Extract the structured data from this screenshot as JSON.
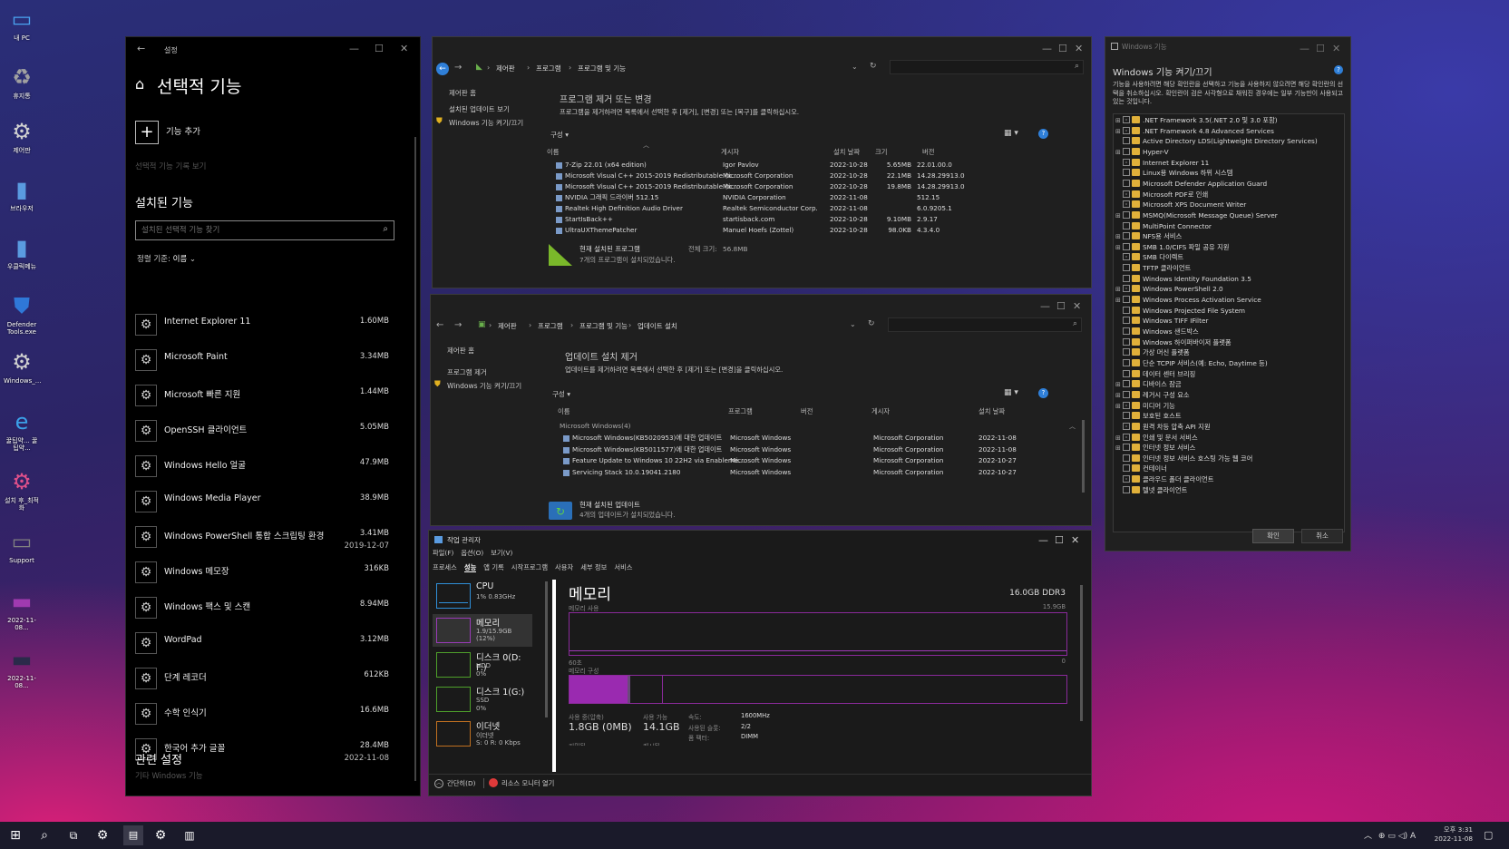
{
  "desktop": {
    "icons": [
      {
        "label": "내 PC",
        "icon": "monitor-icon",
        "color": "#4aa3f0"
      },
      {
        "label": "휴지통",
        "icon": "recycle-bin-icon",
        "color": "#a0a0a0"
      },
      {
        "label": "제어판",
        "icon": "gear-icon",
        "color": "#d0d0d0"
      },
      {
        "label": "브라우저",
        "icon": "document-icon",
        "color": "#5a9be0"
      },
      {
        "label": "우클릭메뉴",
        "icon": "document-icon",
        "color": "#5a9be0"
      },
      {
        "label": "Defender Tools.exe",
        "icon": "shield-icon",
        "color": "#2f78d8"
      },
      {
        "label": "Windows_...",
        "icon": "gear-icon",
        "color": "#d0d0d0"
      },
      {
        "label": "꿀팁약... 꿀팁약...",
        "icon": "ie-icon",
        "color": "#3ba0e8"
      },
      {
        "label": "설치 후_최적화",
        "icon": "gear-icon",
        "color": "#e0508a"
      },
      {
        "label": "Support",
        "icon": "monitor-icon",
        "color": "#808080"
      },
      {
        "label": "2022-11-08...",
        "icon": "screenshot-icon",
        "color": "#a03ab0"
      },
      {
        "label": "2022-11-08...",
        "icon": "screenshot-icon",
        "color": "#2a2a4a"
      }
    ]
  },
  "settings": {
    "title": "설정",
    "page_title": "선택적 기능",
    "add_feature": "기능 추가",
    "history": "선택적 기능 기록 보기",
    "installed_heading": "설치된 기능",
    "search_placeholder": "설치된 선택적 기능 찾기",
    "sort_label": "정렬 기준:",
    "sort_value": "이름",
    "items": [
      {
        "name": "Internet Explorer 11",
        "size": "1.60MB",
        "date": ""
      },
      {
        "name": "Microsoft Paint",
        "size": "3.34MB",
        "date": ""
      },
      {
        "name": "Microsoft 빠른 지원",
        "size": "1.44MB",
        "date": ""
      },
      {
        "name": "OpenSSH 클라이언트",
        "size": "5.05MB",
        "date": ""
      },
      {
        "name": "Windows Hello 얼굴",
        "size": "47.9MB",
        "date": ""
      },
      {
        "name": "Windows Media Player",
        "size": "38.9MB",
        "date": ""
      },
      {
        "name": "Windows PowerShell 통합 스크립팅 환경",
        "size": "3.41MB",
        "date": "2019-12-07"
      },
      {
        "name": "Windows 메모장",
        "size": "316KB",
        "date": ""
      },
      {
        "name": "Windows 팩스 및 스캔",
        "size": "8.94MB",
        "date": ""
      },
      {
        "name": "WordPad",
        "size": "3.12MB",
        "date": ""
      },
      {
        "name": "단계 레코더",
        "size": "612KB",
        "date": ""
      },
      {
        "name": "수학 인식기",
        "size": "16.6MB",
        "date": ""
      },
      {
        "name": "한국어 추가 글꼴",
        "size": "28.4MB",
        "date": "2022-11-08"
      }
    ],
    "related_heading": "관련 설정",
    "related_link": "기타 Windows 기능"
  },
  "programs": {
    "breadcrumb": [
      "제어판",
      "프로그램",
      "프로그램 및 기능"
    ],
    "sidebar": [
      "제어판 홈",
      "설치된 업데이트 보기",
      "Windows 기능 켜기/끄기"
    ],
    "heading": "프로그램 제거 또는 변경",
    "description": "프로그램을 제거하려면 목록에서 선택한 후 [제거], [변경] 또는 [복구]를 클릭하십시오.",
    "organize": "구성",
    "columns": [
      "이름",
      "게시자",
      "설치 날짜",
      "크기",
      "버전"
    ],
    "rows": [
      {
        "name": "7-Zip 22.01 (x64 edition)",
        "publisher": "Igor Pavlov",
        "date": "2022-10-28",
        "size": "5.65MB",
        "version": "22.01.00.0"
      },
      {
        "name": "Microsoft Visual C++ 2015-2019 Redistributable (x...",
        "publisher": "Microsoft Corporation",
        "date": "2022-10-28",
        "size": "22.1MB",
        "version": "14.28.29913.0"
      },
      {
        "name": "Microsoft Visual C++ 2015-2019 Redistributable (x...",
        "publisher": "Microsoft Corporation",
        "date": "2022-10-28",
        "size": "19.8MB",
        "version": "14.28.29913.0"
      },
      {
        "name": "NVIDIA 그래픽 드라이버 512.15",
        "publisher": "NVIDIA Corporation",
        "date": "2022-11-08",
        "size": "",
        "version": "512.15"
      },
      {
        "name": "Realtek High Definition Audio Driver",
        "publisher": "Realtek Semiconductor Corp.",
        "date": "2022-11-08",
        "size": "",
        "version": "6.0.9205.1"
      },
      {
        "name": "StartIsBack++",
        "publisher": "startisback.com",
        "date": "2022-10-28",
        "size": "9.10MB",
        "version": "2.9.17"
      },
      {
        "name": "UltraUXThemePatcher",
        "publisher": "Manuel Hoefs (Zottel)",
        "date": "2022-10-28",
        "size": "98.0KB",
        "version": "4.3.4.0"
      }
    ],
    "footer_title": "현재 설치된 프로그램",
    "footer_total_label": "전체 크기:",
    "footer_total": "56.8MB",
    "footer_count": "7개의 프로그램이 설치되었습니다."
  },
  "updates": {
    "breadcrumb": [
      "제어판",
      "프로그램",
      "프로그램 및 기능",
      "업데이트 설치"
    ],
    "sidebar": [
      "제어판 홈",
      "프로그램 제거",
      "Windows 기능 켜기/끄기"
    ],
    "heading": "업데이트 설치 제거",
    "description": "업데이트를 제거하려면 목록에서 선택한 후 [제거] 또는 [변경]을 클릭하십시오.",
    "organize": "구성",
    "columns": [
      "이름",
      "프로그램",
      "버전",
      "게시자",
      "설치 날짜"
    ],
    "group": "Microsoft Windows(4)",
    "rows": [
      {
        "name": "Microsoft Windows(KB5020953)에 대한 업데이트",
        "program": "Microsoft Windows",
        "publisher": "Microsoft Corporation",
        "date": "2022-11-08"
      },
      {
        "name": "Microsoft Windows(KB5011577)에 대한 업데이트",
        "program": "Microsoft Windows",
        "publisher": "Microsoft Corporation",
        "date": "2022-11-08"
      },
      {
        "name": "Feature Update to Windows 10 22H2 via Enableme...",
        "program": "Microsoft Windows",
        "publisher": "Microsoft Corporation",
        "date": "2022-10-27"
      },
      {
        "name": "Servicing Stack 10.0.19041.2180",
        "program": "Microsoft Windows",
        "publisher": "Microsoft Corporation",
        "date": "2022-10-27"
      }
    ],
    "footer_title": "현재 설치된 업데이트",
    "footer_count": "4개의 업데이트가 설치되었습니다."
  },
  "features": {
    "title": "Windows 기능",
    "heading": "Windows 기능 켜기/끄기",
    "description": "기능을 사용하려면 해당 확인란을 선택하고 기능을 사용하지 않으려면 해당 확인란의 선택을 취소하십시오. 확인란이 검은 사각형으로 채워진 경우에는 일부 기능만이 사용되고 있는 것입니다.",
    "items": [
      {
        "label": ".NET Framework 3.5(.NET 2.0 및 3.0 포함)",
        "expand": true,
        "partial": true
      },
      {
        "label": ".NET Framework 4.8 Advanced Services",
        "expand": true,
        "partial": true
      },
      {
        "label": "Active Directory LDS(Lightweight Directory Services)",
        "expand": false,
        "partial": false
      },
      {
        "label": "Hyper-V",
        "expand": true,
        "partial": false
      },
      {
        "label": "Internet Explorer 11",
        "expand": false,
        "partial": true
      },
      {
        "label": "Linux용 Windows 하위 시스템",
        "expand": false,
        "partial": false
      },
      {
        "label": "Microsoft Defender Application Guard",
        "expand": false,
        "partial": false
      },
      {
        "label": "Microsoft PDF로 인쇄",
        "expand": false,
        "partial": true
      },
      {
        "label": "Microsoft XPS Document Writer",
        "expand": false,
        "partial": true
      },
      {
        "label": "MSMQ(Microsoft Message Queue) Server",
        "expand": true,
        "partial": false
      },
      {
        "label": "MultiPoint Connector",
        "expand": false,
        "partial": false
      },
      {
        "label": "NFS용 서비스",
        "expand": true,
        "partial": false
      },
      {
        "label": "SMB 1.0/CIFS 파일 공유 지원",
        "expand": true,
        "partial": false
      },
      {
        "label": "SMB 다이렉트",
        "expand": false,
        "partial": true
      },
      {
        "label": "TFTP 클라이언트",
        "expand": false,
        "partial": false
      },
      {
        "label": "Windows Identity Foundation 3.5",
        "expand": false,
        "partial": false
      },
      {
        "label": "Windows PowerShell 2.0",
        "expand": true,
        "partial": true
      },
      {
        "label": "Windows Process Activation Service",
        "expand": true,
        "partial": false
      },
      {
        "label": "Windows Projected File System",
        "expand": false,
        "partial": false
      },
      {
        "label": "Windows TIFF IFilter",
        "expand": false,
        "partial": false
      },
      {
        "label": "Windows 샌드박스",
        "expand": false,
        "partial": false
      },
      {
        "label": "Windows 하이퍼바이저 플랫폼",
        "expand": false,
        "partial": false
      },
      {
        "label": "가상 머신 플랫폼",
        "expand": false,
        "partial": false
      },
      {
        "label": "단순 TCPIP 서비스(예: Echo, Daytime 등)",
        "expand": false,
        "partial": false
      },
      {
        "label": "데이터 센터 브리징",
        "expand": false,
        "partial": false
      },
      {
        "label": "디바이스 잠금",
        "expand": true,
        "partial": false
      },
      {
        "label": "레거시 구성 요소",
        "expand": true,
        "partial": false
      },
      {
        "label": "미디어 기능",
        "expand": true,
        "partial": true
      },
      {
        "label": "보호된 호스트",
        "expand": false,
        "partial": false
      },
      {
        "label": "원격 차등 압축 API 지원",
        "expand": false,
        "partial": true
      },
      {
        "label": "인쇄 및 문서 서비스",
        "expand": true,
        "partial": true
      },
      {
        "label": "인터넷 정보 서비스",
        "expand": true,
        "partial": false
      },
      {
        "label": "인터넷 정보 서비스 호스팅 가능 웹 코어",
        "expand": false,
        "partial": false
      },
      {
        "label": "컨테이너",
        "expand": false,
        "partial": false
      },
      {
        "label": "클라우드 폴더 클라이언트",
        "expand": false,
        "partial": true
      },
      {
        "label": "텔넷 클라이언트",
        "expand": false,
        "partial": false
      }
    ],
    "ok": "확인",
    "cancel": "취소"
  },
  "taskmgr": {
    "title": "작업 관리자",
    "menu": [
      "파일(F)",
      "옵션(O)",
      "보기(V)"
    ],
    "tabs": [
      "프로세스",
      "성능",
      "앱 기록",
      "시작프로그램",
      "사용자",
      "세부 정보",
      "서비스"
    ],
    "active_tab": "성능",
    "left": [
      {
        "t1": "CPU",
        "t2": "1% 0.83GHz",
        "t3": "",
        "color": "#2f8fd8"
      },
      {
        "t1": "메모리",
        "t2": "1.9/15.9GB (12%)",
        "t3": "",
        "color": "#9a3ab8"
      },
      {
        "t1": "디스크 0(D: F:)",
        "t2": "HDD",
        "t3": "0%",
        "color": "#4ea02a"
      },
      {
        "t1": "디스크 1(G:)",
        "t2": "SSD",
        "t3": "0%",
        "color": "#4ea02a"
      },
      {
        "t1": "이더넷",
        "t2": "이더넷",
        "t3": "S: 0 R: 0 Kbps",
        "color": "#c07020"
      }
    ],
    "memory": {
      "title": "메모리",
      "total": "16.0GB DDR3",
      "usage_label": "메모리 사용",
      "usage_max": "15.9GB",
      "sec_label": "60초",
      "zero": "0",
      "composition_label": "메모리 구성",
      "in_use_label": "사용 중(압축)",
      "in_use": "1.8GB (0MB)",
      "available_label": "사용 가능",
      "available": "14.1GB",
      "speed_label": "속도:",
      "speed": "1600MHz",
      "slots_label": "사용된 슬롯:",
      "slots": "2/2",
      "form_label": "폼 팩터:",
      "form": "DIMM",
      "committed_label": "커밋됨",
      "cached_label": "캐시됨"
    },
    "footer_simple": "간단히(D)",
    "footer_monitor": "리소스 모니터 열기"
  },
  "taskbar": {
    "time": "오후 3:31",
    "date": "2022-11-08",
    "ime": "A"
  }
}
